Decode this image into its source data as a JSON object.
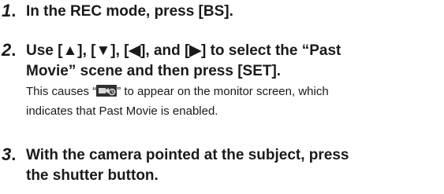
{
  "steps": [
    {
      "number": "1",
      "text": "In the REC mode, press [BS]."
    },
    {
      "number": "2",
      "line1": "Use [▲], [▼], [◀], and [▶] to select the “Past",
      "line2": "Movie” scene and then press [SET].",
      "note_before_icon": "This causes “",
      "note_after_icon": "” to appear on the monitor screen, which",
      "note_line2": "indicates that Past Movie is enabled."
    },
    {
      "number": "3",
      "line1": "With the camera pointed at the subject, press",
      "line2": "the shutter button."
    }
  ],
  "icons": {
    "past_movie_icon": "past-movie-icon"
  }
}
